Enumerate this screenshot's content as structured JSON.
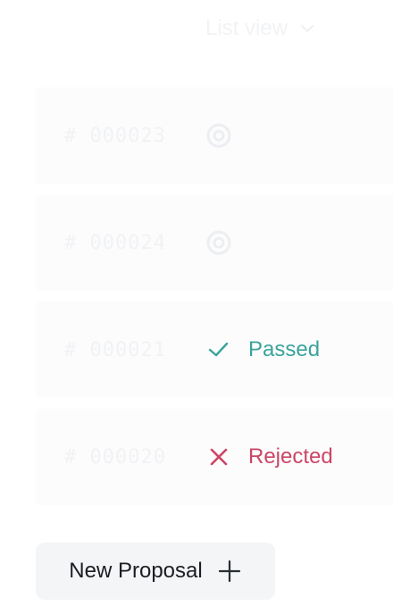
{
  "view_toggle": {
    "label": "List view",
    "icon": "chevron-down-icon"
  },
  "proposals": [
    {
      "id": "# 000023",
      "status": "pending",
      "status_label": "",
      "icon": "target-icon",
      "color": "#f0f1f3"
    },
    {
      "id": "# 000024",
      "status": "pending",
      "status_label": "",
      "icon": "target-icon",
      "color": "#f0f1f3"
    },
    {
      "id": "# 000021",
      "status": "passed",
      "status_label": "Passed",
      "icon": "check-icon",
      "color": "#3aa39b"
    },
    {
      "id": "# 000020",
      "status": "rejected",
      "status_label": "Rejected",
      "icon": "close-icon",
      "color": "#cc4564"
    }
  ],
  "new_proposal": {
    "label": "New Proposal",
    "icon": "plus-icon"
  }
}
